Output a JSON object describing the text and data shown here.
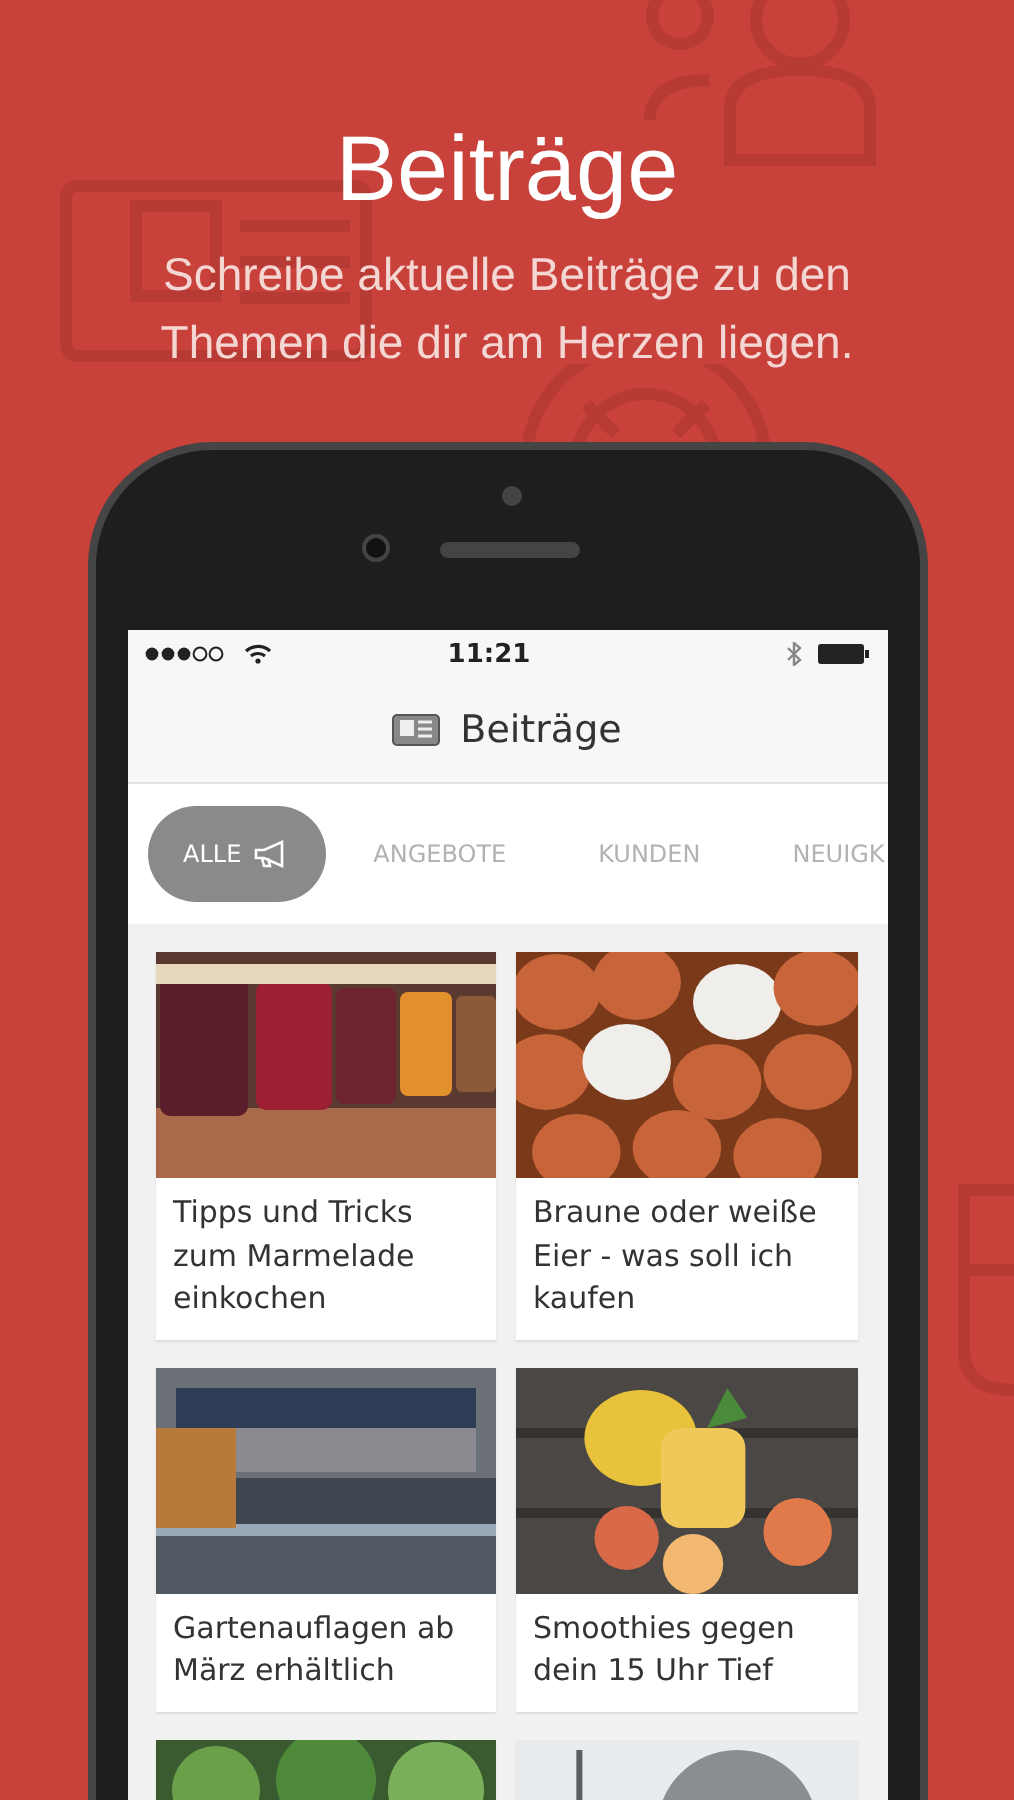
{
  "headline": "Beiträge",
  "subtitle": [
    "Schreibe aktuelle Beiträge zu den",
    "Themen die dir am Herzen liegen."
  ],
  "status_bar": {
    "time": "11:21"
  },
  "nav": {
    "title": "Beiträge"
  },
  "tabs": [
    {
      "label": "ALLE",
      "selected": true
    },
    {
      "label": "ANGEBOTE",
      "selected": false
    },
    {
      "label": "KUNDEN",
      "selected": false
    },
    {
      "label": "NEUIGK",
      "selected": false
    }
  ],
  "posts": [
    {
      "kind": "post",
      "title": "Tipps und Tricks zum Marmelade einkochen"
    },
    {
      "kind": "post",
      "title": "Braune oder weiße Eier - was soll ich kaufen"
    },
    {
      "kind": "post",
      "title": "Gartenauflagen ab März erhältlich"
    },
    {
      "kind": "post",
      "title": "Smoothies gegen dein 15 Uhr Tief"
    },
    {
      "kind": "picture"
    },
    {
      "kind": "picture"
    }
  ]
}
